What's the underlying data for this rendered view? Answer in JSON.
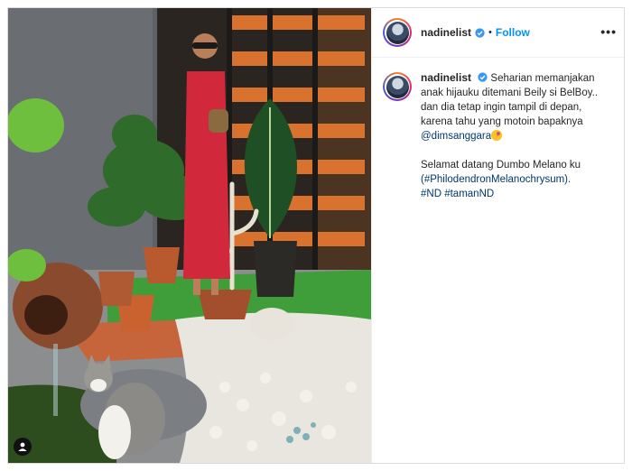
{
  "post": {
    "username": "nadinelist",
    "separator": "•",
    "follow_label": "Follow",
    "more_label": "•••",
    "caption": {
      "line1_text": "Seharian memanjakan anak hijauku ditemani Beily si BelBoy.. dan dia tetap ingin tampil di depan, karena tahu yang motoin bapaknya",
      "mention": "@dimsanggara",
      "line2_text": "Selamat datang Dumbo Melano ku",
      "hashtag_paren": "(#PhilodendronMelanochrysum).",
      "hashtag_1": "#ND",
      "hashtag_2": "#tamanND"
    }
  },
  "colors": {
    "link": "#00376b",
    "follow": "#0095f6",
    "verified": "#3897f0",
    "dress": "#d2283b",
    "fence": "#d9722f"
  },
  "icons": {
    "verified": "verified-badge-icon",
    "user_tag": "user-tag-icon",
    "more": "more-options-icon"
  }
}
